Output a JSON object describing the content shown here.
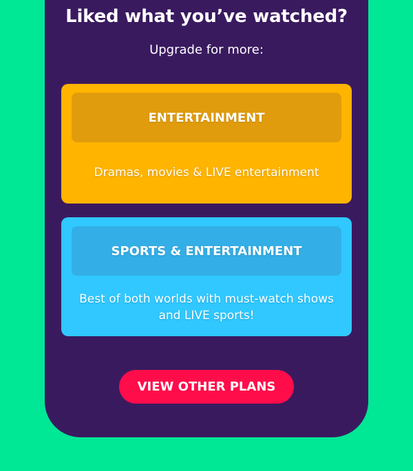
{
  "promo": {
    "title": "Liked what you’ve watched?",
    "subtitle": "Upgrade for more:"
  },
  "plans": [
    {
      "name": "ENTERTAINMENT",
      "description": "Dramas, movies & LIVE entertainment",
      "color": "#ffb400",
      "header_color": "#e09c0c"
    },
    {
      "name": "SPORTS & ENTERTAINMENT",
      "description": "Best of both worlds with must-watch shows and LIVE sports!",
      "color": "#30c8ff",
      "header_color": "#34aee6"
    }
  ],
  "cta": {
    "label": "VIEW OTHER PLANS",
    "color": "#ff0c4b"
  },
  "theme": {
    "background": "#00e796",
    "panel": "#3a1a5f"
  }
}
